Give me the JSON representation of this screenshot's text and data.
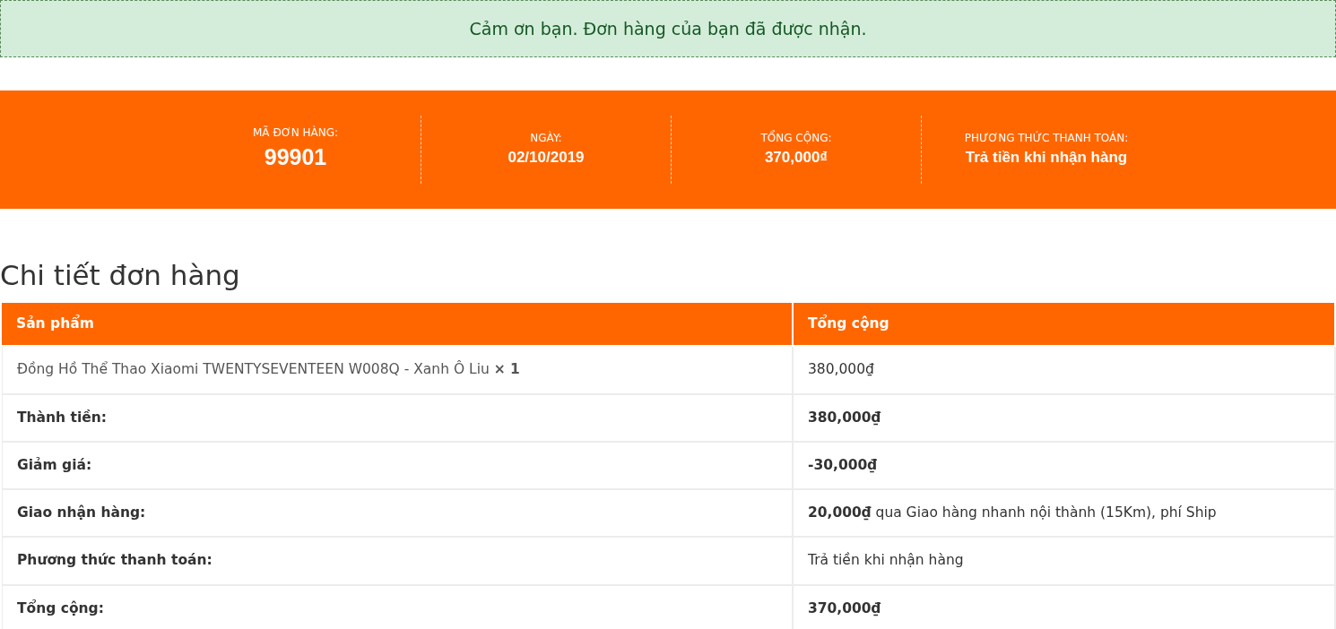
{
  "notice": "Cảm ơn bạn. Đơn hàng của bạn đã được nhận.",
  "overview": [
    {
      "label": "MÃ ĐƠN HÀNG:",
      "value": "99901",
      "kind": "large"
    },
    {
      "label": "NGÀY:",
      "value": "02/10/2019",
      "kind": "normal"
    },
    {
      "label": "TỔNG CỘNG:",
      "value": "370,000₫",
      "kind": "normal"
    },
    {
      "label": "PHƯƠNG THỨC THANH TOÁN:",
      "value": "Trả tiền khi nhận hàng",
      "kind": "normal"
    }
  ],
  "heading": "Chi tiết đơn hàng",
  "table": {
    "columns": [
      "Sản phẩm",
      "Tổng cộng"
    ],
    "rows": [
      {
        "kind": "item",
        "cells": [
          "Đồng Hồ Thể Thao Xiaomi TWENTYSEVENTEEN W008Q - Xanh Ô Liu **× 1**",
          "380,000₫"
        ]
      },
      {
        "kind": "summary",
        "cells": [
          "Thành tiền:",
          "**380,000₫**"
        ]
      },
      {
        "kind": "summary",
        "cells": [
          "Giảm giá:",
          "**-30,000₫**"
        ]
      },
      {
        "kind": "summary",
        "cells": [
          "Giao nhận hàng:",
          "**20,000₫** qua Giao hàng nhanh nội thành (15Km), phí Ship"
        ]
      },
      {
        "kind": "summary",
        "cells": [
          "Phương thức thanh toán:",
          "Trả tiền khi nhận hàng"
        ]
      },
      {
        "kind": "summary",
        "cells": [
          "Tổng cộng:",
          "**370,000₫**"
        ]
      }
    ]
  }
}
